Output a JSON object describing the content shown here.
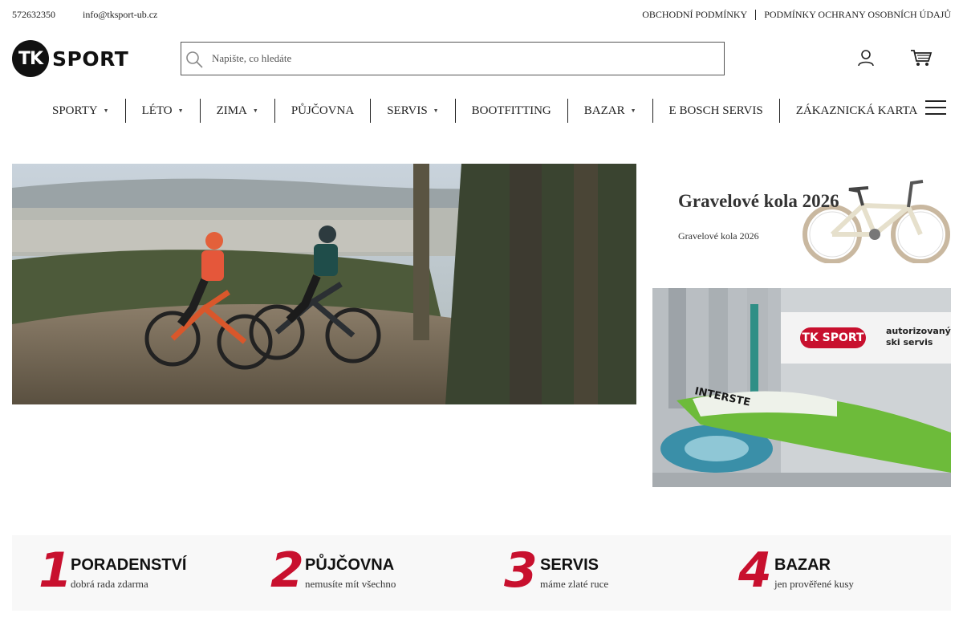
{
  "topbar": {
    "phone": "572632350",
    "email": "info@tksport-ub.cz",
    "links": [
      "OBCHODNÍ PODMÍNKY",
      "PODMÍNKY OCHRANY OSOBNÍCH ÚDAJŮ"
    ]
  },
  "logo": {
    "mark": "TK",
    "word": "SPORT"
  },
  "search": {
    "placeholder": "Napište, co hledáte",
    "value": ""
  },
  "icons": {
    "search": "search-icon",
    "user": "user-icon",
    "cart": "cart-icon",
    "menu": "hamburger-menu-icon"
  },
  "nav": {
    "items": [
      {
        "label": "SPORTY",
        "dropdown": true
      },
      {
        "label": "LÉTO",
        "dropdown": true
      },
      {
        "label": "ZIMA",
        "dropdown": true
      },
      {
        "label": "PŮJČOVNA",
        "dropdown": false
      },
      {
        "label": "SERVIS",
        "dropdown": true
      },
      {
        "label": "BOOTFITTING",
        "dropdown": false
      },
      {
        "label": "BAZAR",
        "dropdown": true
      },
      {
        "label": "E BOSCH SERVIS",
        "dropdown": false
      },
      {
        "label": "ZÁKAZNICKÁ KARTA",
        "dropdown": false
      }
    ]
  },
  "hero": {
    "prev_glyph": "",
    "next_glyph": ""
  },
  "promo": {
    "title": "Gravelové kola 2026",
    "subtitle": "Gravelové kola 2026"
  },
  "ski_banner": {
    "logo_mark": "TK SPORT",
    "tagline_1": "autorizovaný",
    "tagline_2": "ski servis",
    "machine_text": "INTERSTE"
  },
  "features": [
    {
      "num": "1",
      "title": "PORADENSTVÍ",
      "subtitle": "dobrá rada zdarma"
    },
    {
      "num": "2",
      "title": "PŮJČOVNA",
      "subtitle": "nemusíte mít všechno"
    },
    {
      "num": "3",
      "title": "SERVIS",
      "subtitle": "máme zlaté ruce"
    },
    {
      "num": "4",
      "title": "BAZAR",
      "subtitle": "jen prověřené kusy"
    }
  ],
  "colors": {
    "accent": "#c8102e",
    "text": "#222222",
    "feature_bg": "#f8f8f8"
  }
}
